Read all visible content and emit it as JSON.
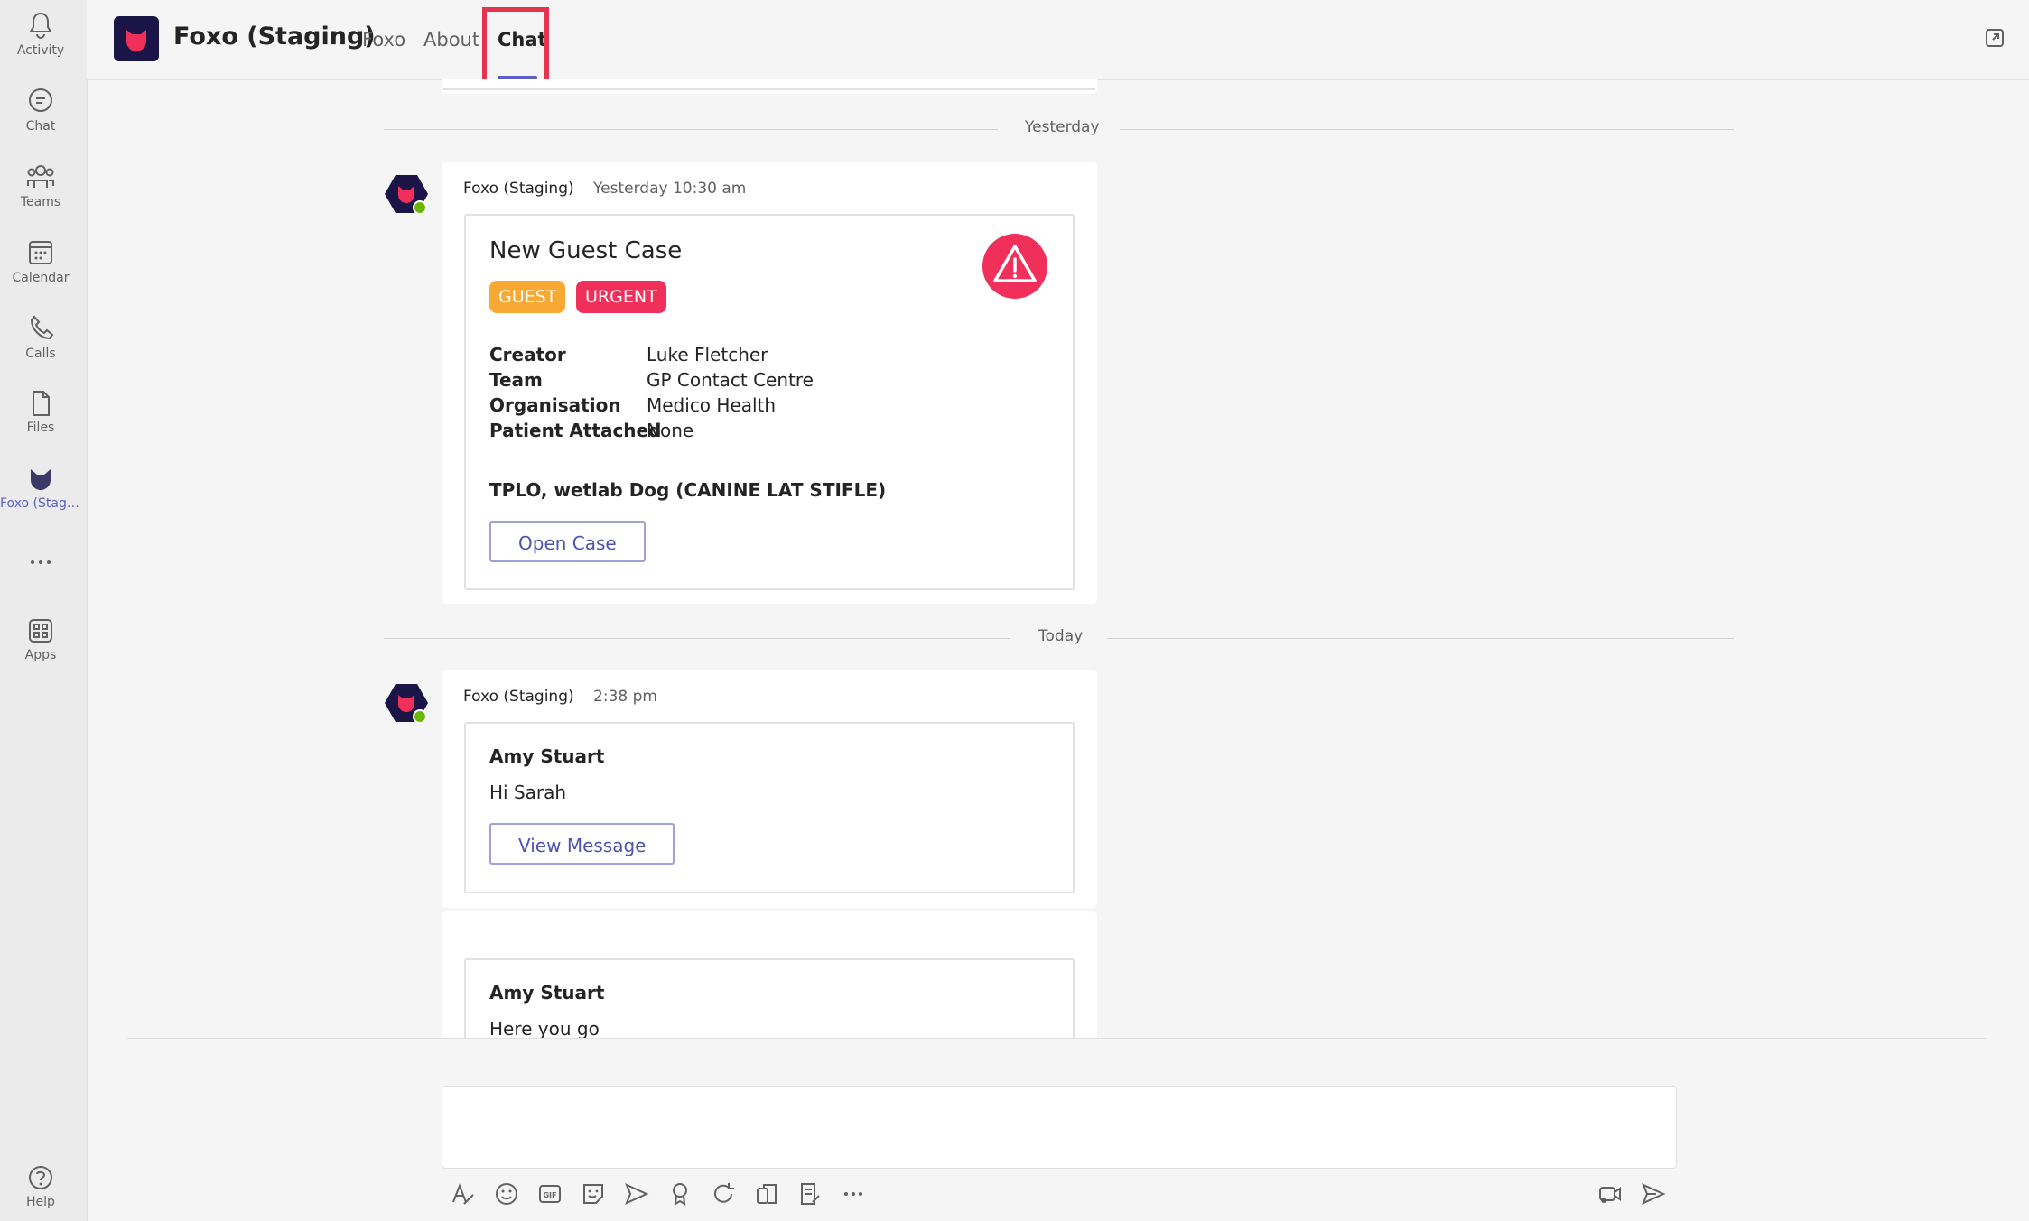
{
  "rail": {
    "items": [
      {
        "label": "Activity",
        "icon": "bell-icon"
      },
      {
        "label": "Chat",
        "icon": "chat-icon"
      },
      {
        "label": "Teams",
        "icon": "teams-icon"
      },
      {
        "label": "Calendar",
        "icon": "calendar-icon"
      },
      {
        "label": "Calls",
        "icon": "phone-icon"
      },
      {
        "label": "Files",
        "icon": "file-icon"
      },
      {
        "label": "Foxo (Stagi...",
        "icon": "foxo-icon"
      },
      {
        "label": "",
        "icon": "more-icon"
      },
      {
        "label": "Apps",
        "icon": "apps-icon"
      },
      {
        "label": "Help",
        "icon": "help-icon"
      }
    ]
  },
  "header": {
    "app_title": "Foxo (Staging)",
    "tabs": [
      {
        "label": "Foxo"
      },
      {
        "label": "About"
      },
      {
        "label": "Chat"
      }
    ],
    "active_tab": "Chat"
  },
  "dates": {
    "yesterday": "Yesterday",
    "today": "Today"
  },
  "messages": [
    {
      "sender": "Foxo (Staging)",
      "time": "Yesterday 10:30 am",
      "card": {
        "title": "New Guest Case",
        "badges": [
          {
            "label": "GUEST",
            "color": "#f7a933"
          },
          {
            "label": "URGENT",
            "color": "#f0305a"
          }
        ],
        "facts": [
          {
            "key": "Creator",
            "value": "Luke Fletcher"
          },
          {
            "key": "Team",
            "value": "GP Contact Centre"
          },
          {
            "key": "Organisation",
            "value": "Medico Health"
          },
          {
            "key": "Patient Attached",
            "value": "None"
          }
        ],
        "description": "TPLO, wetlab Dog (CANINE LAT STIFLE)",
        "button": "Open Case"
      }
    },
    {
      "sender": "Foxo (Staging)",
      "time": "2:38 pm",
      "card": {
        "from": "Amy Stuart",
        "text": "Hi Sarah",
        "button": "View Message"
      }
    },
    {
      "card": {
        "from": "Amy Stuart",
        "text": "Here you go"
      }
    }
  ],
  "colors": {
    "accent": "#5b5fc7",
    "highlight": "#e5344f",
    "guest": "#f7a933",
    "urgent": "#f0305a"
  }
}
